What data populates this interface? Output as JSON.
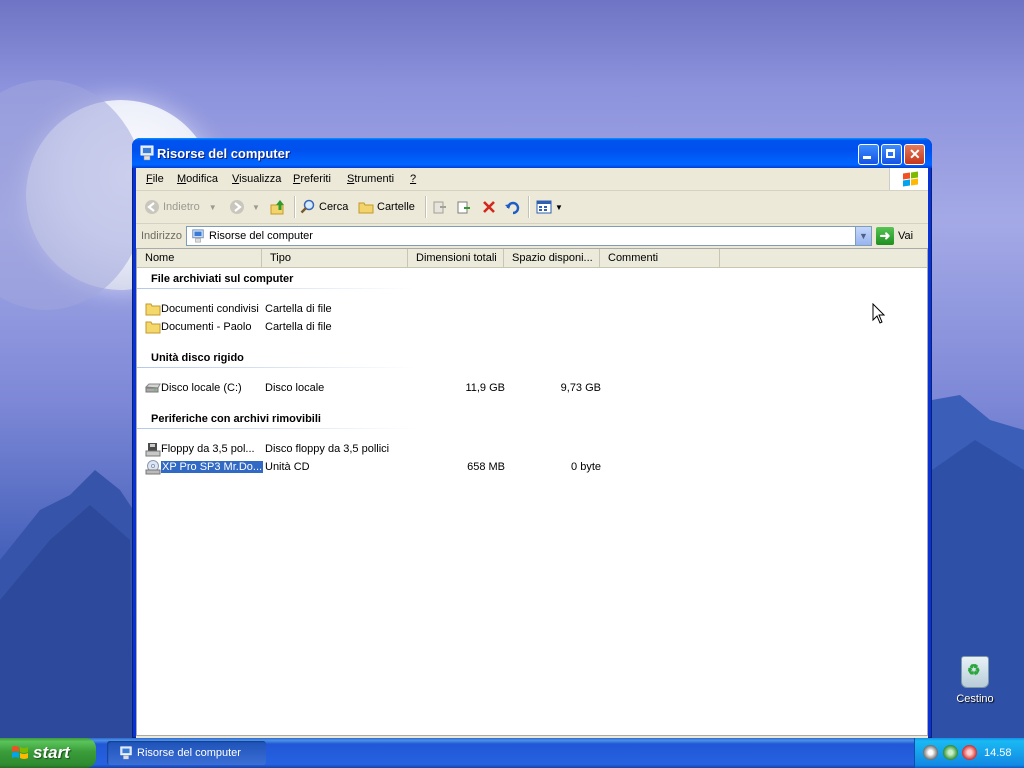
{
  "window": {
    "title": "Risorse del computer",
    "menu": [
      "File",
      "Modifica",
      "Visualizza",
      "Preferiti",
      "Strumenti",
      "?"
    ],
    "menu_underline": [
      "F",
      "M",
      "V",
      "P",
      "S",
      "?"
    ],
    "toolbar": {
      "back_label": "Indietro",
      "search_label": "Cerca",
      "folders_label": "Cartelle"
    },
    "address": {
      "label": "Indirizzo",
      "value": "Risorse del computer",
      "go_label": "Vai"
    },
    "columns": [
      "Nome",
      "Tipo",
      "Dimensioni totali",
      "Spazio disponi...",
      "Commenti"
    ],
    "groups": [
      {
        "title": "File archiviati sul computer",
        "items": [
          {
            "name": "Documenti condivisi",
            "type": "Cartella di file",
            "size": "",
            "free": "",
            "icon": "folder-icon"
          },
          {
            "name": "Documenti - Paolo",
            "type": "Cartella di file",
            "size": "",
            "free": "",
            "icon": "folder-icon"
          }
        ]
      },
      {
        "title": "Unità disco rigido",
        "items": [
          {
            "name": "Disco locale (C:)",
            "type": "Disco locale",
            "size": "11,9 GB",
            "free": "9,73 GB",
            "icon": "hard-disk-icon"
          }
        ]
      },
      {
        "title": "Periferiche con archivi rimovibili",
        "items": [
          {
            "name": "Floppy da 3,5 pol...",
            "type": "Disco floppy da 3,5 pollici",
            "size": "",
            "free": "",
            "icon": "floppy-drive-icon"
          },
          {
            "name": "XP Pro SP3 Mr.Do...",
            "type": "Unità CD",
            "size": "658 MB",
            "free": "0 byte",
            "icon": "cd-drive-icon",
            "selected": true
          }
        ]
      }
    ]
  },
  "desktop": {
    "recycle_bin_label": "Cestino"
  },
  "taskbar": {
    "start_label": "start",
    "task_button_label": "Risorse del computer",
    "clock": "14.58"
  }
}
